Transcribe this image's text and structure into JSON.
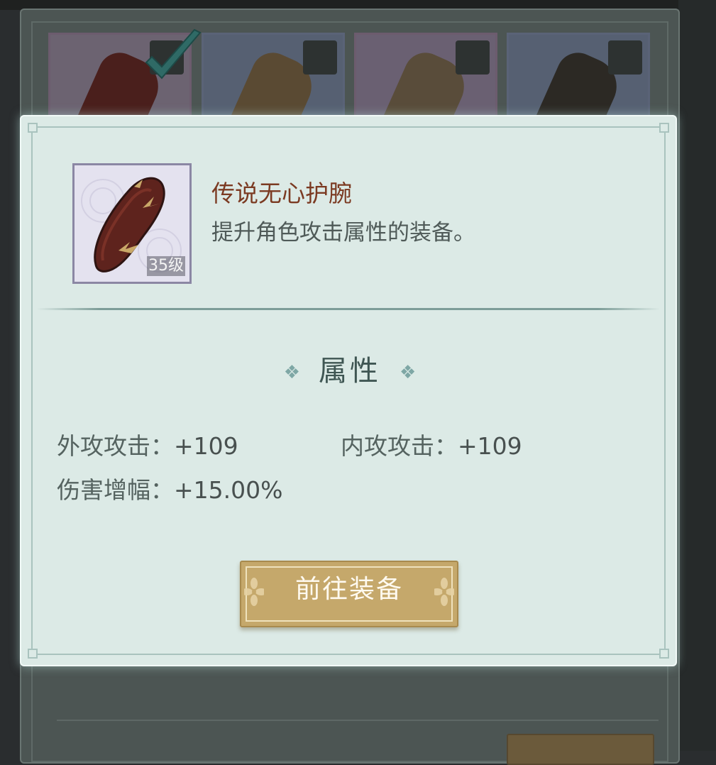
{
  "item": {
    "name": "传说无心护腕",
    "description": "提升角色攻击属性的装备。",
    "level": "35级",
    "icon": "bracer-icon"
  },
  "attributes": {
    "title": "属性",
    "stats": [
      {
        "label": "外攻攻击：",
        "value": "+109"
      },
      {
        "label": "内攻攻击：",
        "value": "+109"
      },
      {
        "label": "伤害增幅：",
        "value": "+15.00%"
      }
    ]
  },
  "action": {
    "label": "前往装备"
  },
  "colors": {
    "item_name": "#7b3a22",
    "dialog_bg": "#dceae6",
    "button_gold": "#c5a86b"
  }
}
